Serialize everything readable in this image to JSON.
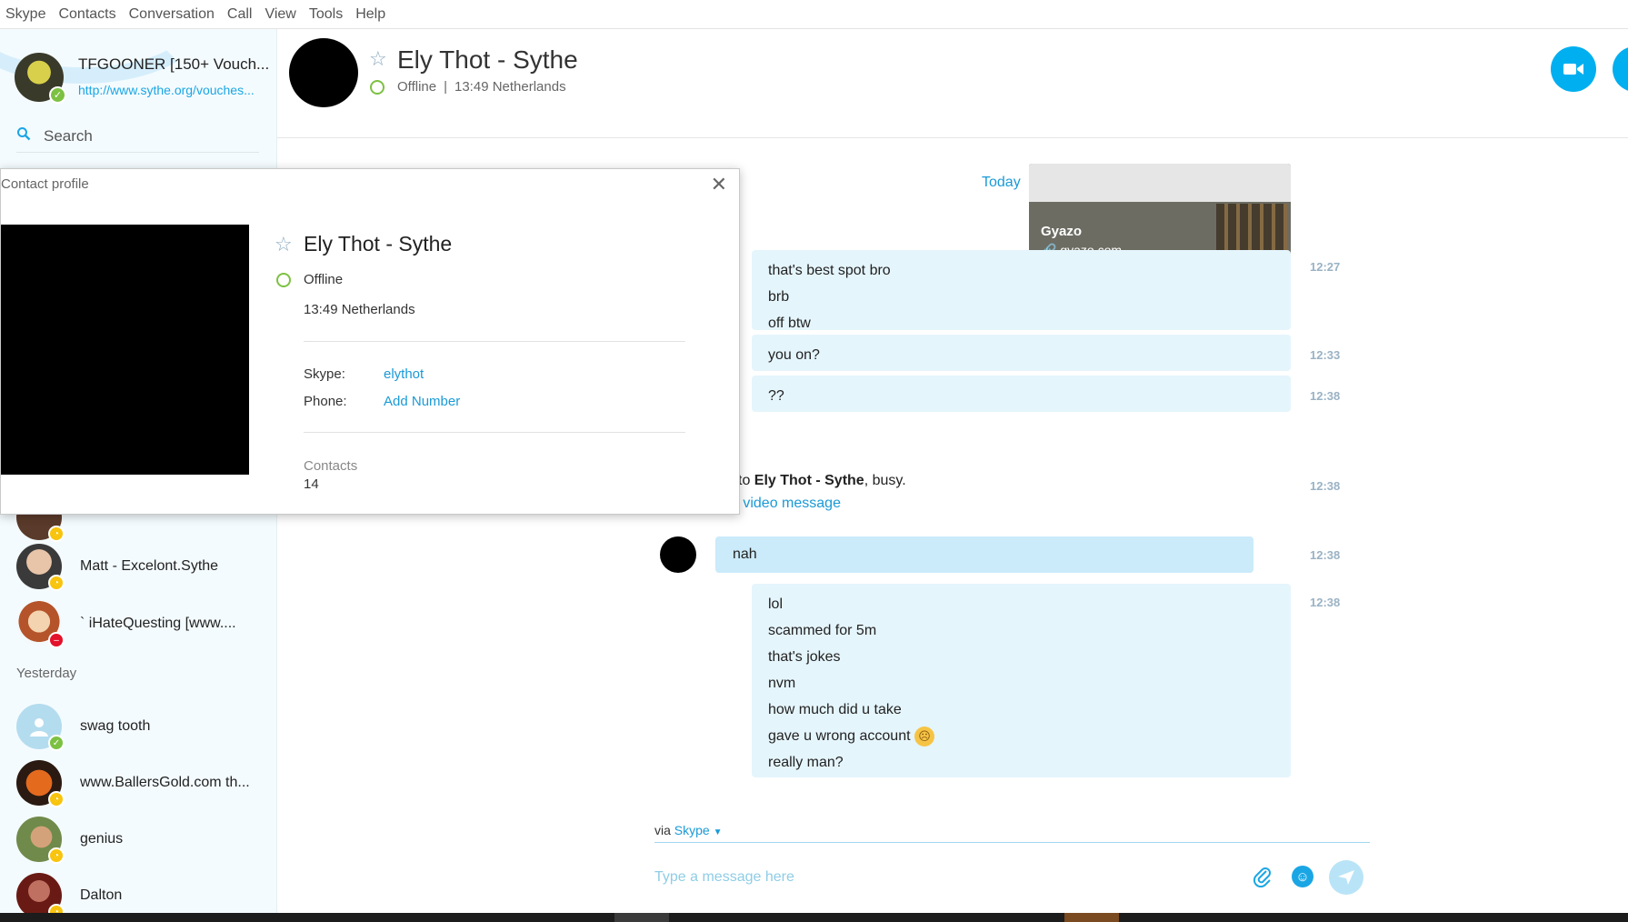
{
  "menu": [
    "Skype",
    "Contacts",
    "Conversation",
    "Call",
    "View",
    "Tools",
    "Help"
  ],
  "me": {
    "name": "TFGOONER [150+ Vouch...",
    "mood_link": "http://www.sythe.org/vouches..."
  },
  "search": {
    "label": "Search"
  },
  "contacts_recent": [
    {
      "name": "Matt - Excelont.Sythe",
      "status": "away"
    },
    {
      "name": "` iHateQuesting [www....",
      "status": "dnd"
    }
  ],
  "section_yesterday": "Yesterday",
  "contacts_yesterday": [
    {
      "name": "swag tooth",
      "status": "online"
    },
    {
      "name": "www.BallersGold.com th...",
      "status": "away"
    },
    {
      "name": "genius",
      "status": "away"
    },
    {
      "name": "Dalton",
      "status": "away"
    }
  ],
  "chat": {
    "contact_name": "Ely Thot - Sythe",
    "status": "Offline",
    "separator": "|",
    "local_time": "13:49 Netherlands",
    "today_label": "Today",
    "link_preview": {
      "title": "Gyazo",
      "url": "gyazo.com"
    },
    "messages": [
      {
        "lines": [
          "that's best spot bro",
          "brb",
          "off btw"
        ],
        "time": "12:27"
      },
      {
        "lines": [
          "you on?"
        ],
        "time": "12:33"
      },
      {
        "lines": [
          "??"
        ],
        "time": "12:38"
      },
      {
        "lines": [
          "nah"
        ],
        "time": "12:38"
      },
      {
        "lines": [
          "lol",
          "scammed for 5m",
          "that's jokes",
          "nvm",
          "how much did u take",
          "gave u wrong account",
          "really man?"
        ],
        "time": "12:38"
      }
    ],
    "system_message": {
      "prefix": "l to",
      "name": "Ely Thot - Sythe",
      "suffix": ", busy.",
      "link": "d video message",
      "time": "12:38"
    },
    "via_label": "via",
    "via_service": "Skype",
    "compose_placeholder": "Type a message here"
  },
  "profile": {
    "title": "Contact profile",
    "name": "Ely Thot - Sythe",
    "status": "Offline",
    "local_time": "13:49 Netherlands",
    "skype_label": "Skype:",
    "skype_value": "elythot",
    "phone_label": "Phone:",
    "phone_value": "Add Number",
    "contacts_label": "Contacts",
    "contacts_count": "14"
  },
  "colors": {
    "accent": "#00aff0",
    "link": "#1a9ad6",
    "bubble_out": "#e5f5fc",
    "bubble_in": "#cbeafa",
    "online": "#7cc142",
    "away": "#f8c40d",
    "dnd": "#e3112b"
  }
}
